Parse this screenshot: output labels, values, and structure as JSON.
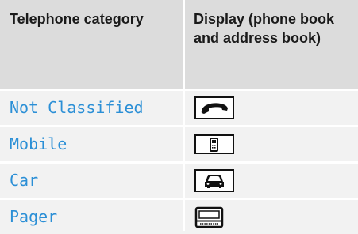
{
  "table": {
    "headers": {
      "category": "Telephone category",
      "display": "Display (phone book and address book)"
    },
    "rows": [
      {
        "category": "Not Classified",
        "icon": "handset-icon"
      },
      {
        "category": "Mobile",
        "icon": "mobile-phone-icon"
      },
      {
        "category": "Car",
        "icon": "car-icon"
      },
      {
        "category": "Pager",
        "icon": "pager-icon"
      }
    ]
  },
  "colors": {
    "header_bg": "#dcdcdc",
    "row_bg": "#f2f2f2",
    "label_text": "#2b8fd6",
    "header_text": "#1a1a1a"
  }
}
